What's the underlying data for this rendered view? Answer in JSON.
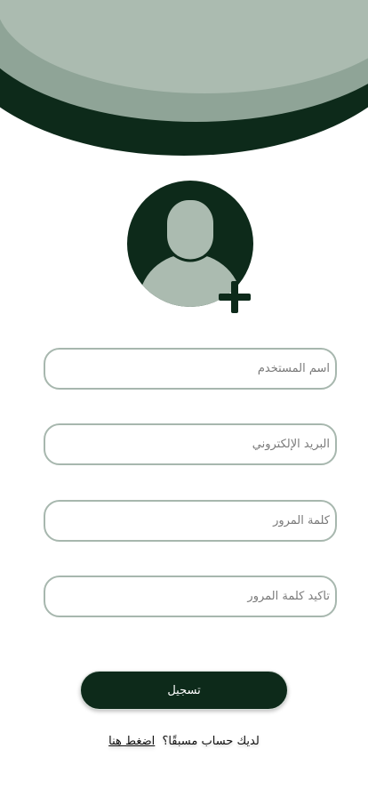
{
  "form": {
    "username_placeholder": "اسم المستخدم",
    "email_placeholder": "البريد الإلكتروني",
    "password_placeholder": "كلمة المرور",
    "confirm_password_placeholder": "تأكيد كلمة المرور"
  },
  "actions": {
    "register_label": "تسجيل",
    "login_prompt": "لديك حساب مسبقًا؟",
    "login_link": "اضغط هنا"
  },
  "icons": {
    "avatar": "user-silhouette-icon",
    "add": "plus-icon"
  },
  "colors": {
    "primary_dark": "#0d2a1a",
    "header_mid": "#8fa497",
    "header_light": "#abbbb0",
    "input_border": "#a7b7ae",
    "background": "#ffffff"
  }
}
